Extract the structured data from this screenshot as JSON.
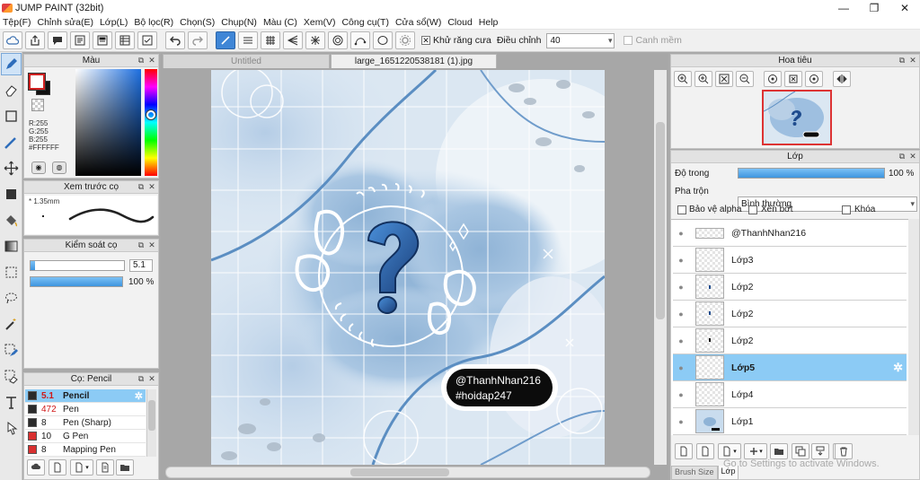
{
  "window": {
    "title": "JUMP PAINT (32bit)",
    "controls": [
      "—",
      "❐",
      "✕"
    ]
  },
  "menu": [
    "Tệp(F)",
    "Chỉnh sửa(E)",
    "Lớp(L)",
    "Bộ lọc(R)",
    "Chọn(S)",
    "Chụp(N)",
    "Màu (C)",
    "Xem(V)",
    "Công cụ(T)",
    "Cửa sổ(W)",
    "Cloud",
    "Help"
  ],
  "toolbar": {
    "antialias_label": "Khử răng cưa",
    "adjust_label": "Điều chỉnh",
    "adjust_value": "40",
    "canh_mem_label": "Canh mềm"
  },
  "color_panel": {
    "title": "Màu",
    "r": "R:255",
    "g": "G:255",
    "b": "B:255",
    "hex": "#FFFFFF"
  },
  "brush_preview": {
    "title": "Xem trước cọ",
    "size": "1.35mm"
  },
  "brush_control": {
    "title": "Kiểm soát cọ",
    "size_value": "5.1",
    "opacity_value": "100 %",
    "opacity": 1.0,
    "size_fill": 0.05
  },
  "brush_list": {
    "title": "Cọ: Pencil",
    "items": [
      {
        "size": "5.1",
        "name": "Pencil",
        "color": "#2a2a2a",
        "selected": true,
        "size_red": true
      },
      {
        "size": "472",
        "name": "Pen",
        "color": "#2a2a2a",
        "size_red": true
      },
      {
        "size": "8",
        "name": "Pen (Sharp)",
        "color": "#2a2a2a"
      },
      {
        "size": "10",
        "name": "G Pen",
        "color": "#d93030"
      },
      {
        "size": "8",
        "name": "Mapping Pen",
        "color": "#d93030"
      }
    ]
  },
  "canvas": {
    "tabs": [
      {
        "label": "Untitled",
        "active": false
      },
      {
        "label": "large_1651220538181 (1).jpg",
        "active": true
      }
    ],
    "overlay_lines": [
      "@ThanhNhan216",
      "#hoidap247"
    ],
    "question_mark": "?"
  },
  "navigator": {
    "title": "Hoa tiêu"
  },
  "layer_panel": {
    "title": "Lớp",
    "opacity_label": "Độ trong",
    "opacity_value": "100 %",
    "opacity": 1.0,
    "blend_label": "Pha trộn",
    "blend_value": "Bình thường",
    "protect_alpha": "Bảo vệ alpha",
    "clip": "Xén bớt",
    "lock": "Khóa",
    "layers": [
      {
        "name": "@ThanhNhan216",
        "selected": false
      },
      {
        "name": "Lớp3",
        "selected": false
      },
      {
        "name": "Lớp2",
        "selected": false
      },
      {
        "name": "Lớp2",
        "selected": false
      },
      {
        "name": "Lớp2",
        "selected": false
      },
      {
        "name": "Lớp5",
        "selected": true
      },
      {
        "name": "Lớp4",
        "selected": false
      },
      {
        "name": "Lớp1",
        "selected": false
      }
    ],
    "bottom_tabs": [
      "Brush Size",
      "Lớp"
    ]
  },
  "watermark": "Go to Settings to activate Windows."
}
